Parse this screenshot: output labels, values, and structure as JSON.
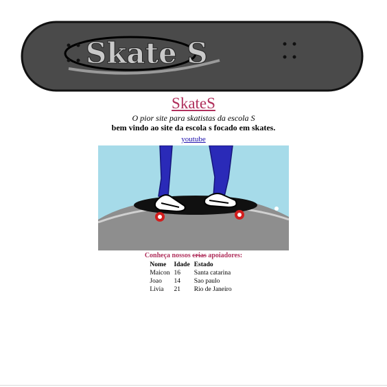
{
  "banner": {
    "logo_text": "Skate S"
  },
  "header": {
    "title": "SkateS",
    "tagline": "O pior site para skatistas da escola S",
    "welcome": "bem vindo ao site da escola s focado em skates.",
    "link_label": "youtube"
  },
  "supporters": {
    "title_part1": "Conheça nossos",
    "title_strike": " crias",
    "title_part2": "apoiadores:",
    "columns": [
      "Nome",
      "Idade",
      "Estado"
    ],
    "rows": [
      [
        "Maicon",
        "16",
        "Santa catarina"
      ],
      [
        "Joao",
        "14",
        "Sao paulo"
      ],
      [
        "Livia",
        "21",
        "Rio de Janeiro"
      ]
    ]
  }
}
